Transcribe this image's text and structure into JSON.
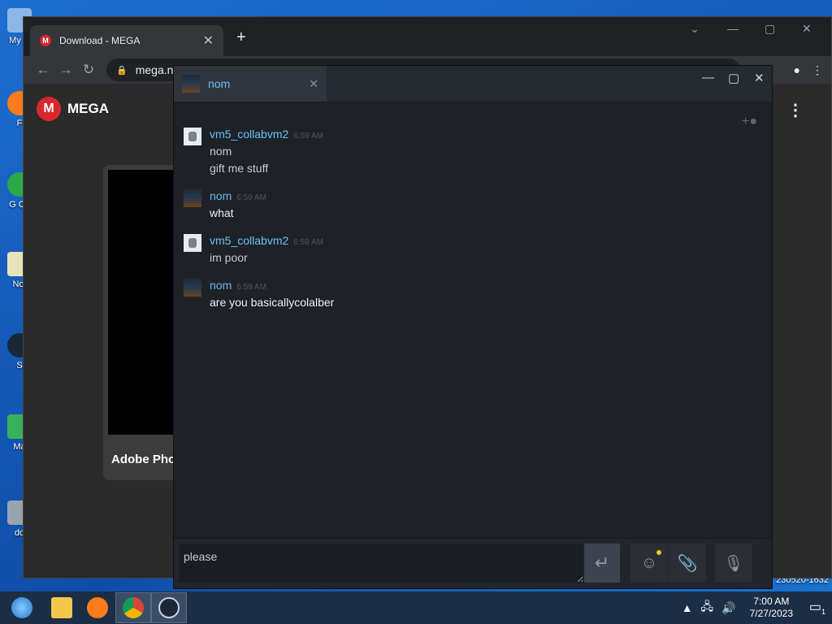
{
  "desktop": {
    "icons": [
      {
        "label": "My C"
      },
      {
        "label": "F"
      },
      {
        "label": "G\nCh"
      },
      {
        "label": "Not"
      },
      {
        "label": "S"
      },
      {
        "label": "Ma"
      },
      {
        "label": "do"
      }
    ],
    "build_text": "230520-1632"
  },
  "browser": {
    "tab_title": "Download - MEGA",
    "url": "mega.n",
    "logo_text": "MEGA",
    "card_title": "Adobe Pho"
  },
  "steam_chat": {
    "tab_name": "nom",
    "messages": [
      {
        "sender": "vm5_collabvm2",
        "time": "6:59 AM",
        "lines": [
          "nom",
          "gift me stuff"
        ],
        "self": false
      },
      {
        "sender": "nom",
        "time": "6:59 AM",
        "lines": [
          "what"
        ],
        "self": true
      },
      {
        "sender": "vm5_collabvm2",
        "time": "6:59 AM",
        "lines": [
          "im poor"
        ],
        "self": false
      },
      {
        "sender": "nom",
        "time": "6:59 AM",
        "lines": [
          "are you basicallycolalber"
        ],
        "self": true
      }
    ],
    "input_value": "please"
  },
  "taskbar": {
    "time": "7:00 AM",
    "date": "7/27/2023",
    "notification_count": "1"
  },
  "colors": {
    "steam_name": "#67c1f5",
    "mega_red": "#d9272e"
  }
}
